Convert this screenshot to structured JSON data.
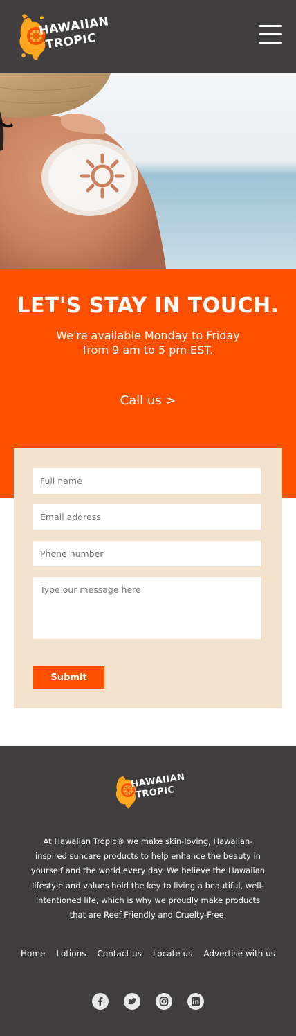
{
  "brand": {
    "name_line1": "HAWAIIAN",
    "name_line2": "TROPIC",
    "accent_color": "#ff5000",
    "dark_color": "#3f3d3e",
    "cream_color": "#f3e3ce"
  },
  "header": {
    "menu_icon": "hamburger-menu-icon"
  },
  "contact": {
    "title": "LET'S STAY IN TOUCH.",
    "subtitle_line1": "We're available Monday to Friday",
    "subtitle_line2": "from 9 am to 5 pm EST.",
    "call_link": "Call us >"
  },
  "form": {
    "full_name_placeholder": "Full name",
    "email_placeholder": "Email address",
    "phone_placeholder": "Phone number",
    "message_placeholder": "Type our message here",
    "submit_label": "Submit"
  },
  "footer": {
    "description": "At Hawaiian Tropic® we make skin-loving, Hawaiian-inspired suncare products to help enhance the beauty in yourself and the world every day. We believe the Hawaiian lifestyle and values hold the key to living a beautiful, well-intentioned life, which is why we proudly make products that are Reef Friendly and Cruelty-Free.",
    "nav": [
      "Home",
      "Lotions",
      "Contact us",
      "Locate us",
      "Advertise with us"
    ],
    "socials": [
      "facebook-icon",
      "twitter-icon",
      "instagram-icon",
      "linkedin-icon"
    ]
  }
}
